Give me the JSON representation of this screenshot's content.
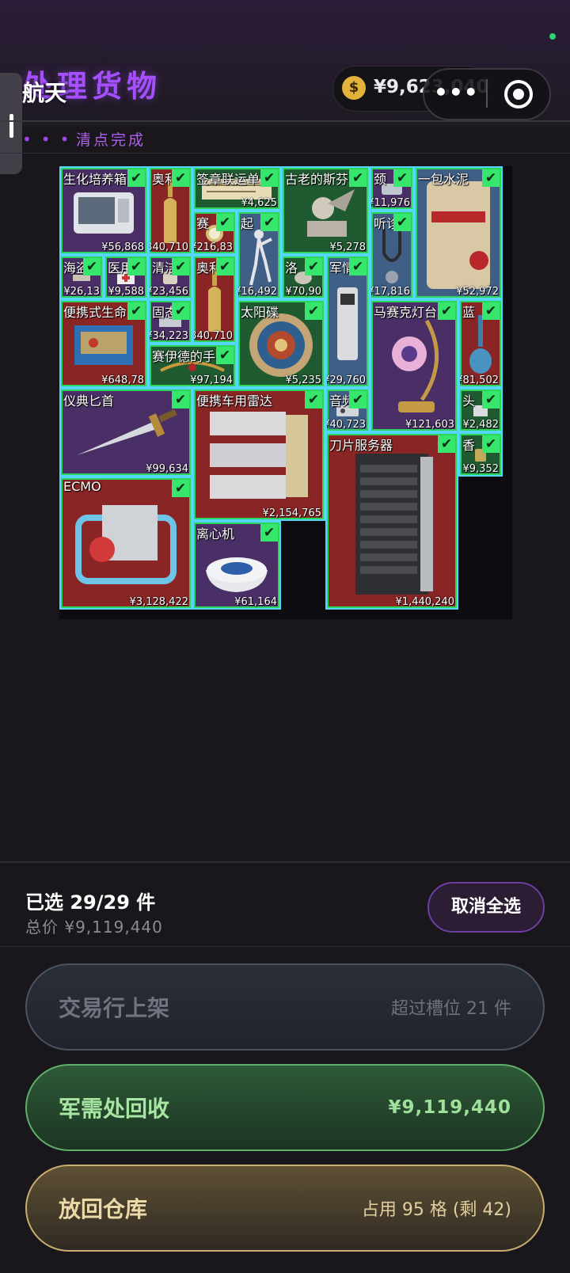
{
  "header": {
    "title": "处理货物",
    "miniprogram_name": "航天",
    "balance": "¥9,623,040",
    "capsule_dots": "•••",
    "status_dots": "•••",
    "status": "清点完成"
  },
  "items": [
    {
      "name": "生化培养箱",
      "price": "¥56,868",
      "bg": "purple"
    },
    {
      "name": "奥利",
      "price": "340,710",
      "bg": "red"
    },
    {
      "name": "签章联运单",
      "price": "¥4,625",
      "bg": "green"
    },
    {
      "name": "古老的斯芬",
      "price": "¥5,278",
      "bg": "green"
    },
    {
      "name": "颈",
      "price": "¥11,976",
      "bg": "purple"
    },
    {
      "name": "一包水泥",
      "price": "¥52,972",
      "bg": "blue"
    },
    {
      "name": "赛",
      "price": "¥216,83",
      "bg": "red"
    },
    {
      "name": "起",
      "price": "¥16,492",
      "bg": "blue"
    },
    {
      "name": "听诊",
      "price": "¥17,816",
      "bg": "blue"
    },
    {
      "name": "海盗",
      "price": "¥26,13",
      "bg": "purple"
    },
    {
      "name": "医用",
      "price": "¥9,588",
      "bg": "purple"
    },
    {
      "name": "清洁",
      "price": "¥23,456",
      "bg": "purple"
    },
    {
      "name": "奥利",
      "price": "340,710",
      "bg": "red"
    },
    {
      "name": "洛",
      "price": "¥70,90",
      "bg": "green"
    },
    {
      "name": "军情",
      "price": "¥29,760",
      "bg": "blue"
    },
    {
      "name": "便携式生命",
      "price": "¥648,78",
      "bg": "red"
    },
    {
      "name": "固态",
      "price": "¥34,223",
      "bg": "purple"
    },
    {
      "name": "太阳碟",
      "price": "¥5,235",
      "bg": "green"
    },
    {
      "name": "马赛克灯台",
      "price": "¥121,603",
      "bg": "purple"
    },
    {
      "name": "蓝",
      "price": "¥81,502",
      "bg": "red"
    },
    {
      "name": "赛伊德的手",
      "price": "¥97,194",
      "bg": "green"
    },
    {
      "name": "仪典匕首",
      "price": "¥99,634",
      "bg": "purple"
    },
    {
      "name": "便携车用雷达",
      "price": "¥2,154,765",
      "bg": "red"
    },
    {
      "name": "音频",
      "price": "¥40,723",
      "bg": "blue"
    },
    {
      "name": "头",
      "price": "¥2,482",
      "bg": "green"
    },
    {
      "name": "刀片服务器",
      "price": "¥1,440,240",
      "bg": "red"
    },
    {
      "name": "香",
      "price": "¥9,352",
      "bg": "green"
    },
    {
      "name": "ECMO",
      "price": "¥3,128,422",
      "bg": "red"
    },
    {
      "name": "离心机",
      "price": "¥61,164",
      "bg": "purple"
    }
  ],
  "summary": {
    "selected": "已选 29/29 件",
    "total": "总价 ¥9,119,440",
    "deselect_label": "取消全选"
  },
  "actions": {
    "market_label": "交易行上架",
    "market_sub": "超过槽位 21 件",
    "recycle_label": "军需处回收",
    "recycle_sub": "¥9,119,440",
    "warehouse_label": "放回仓库",
    "warehouse_sub": "占用 95 格 (剩 42)"
  }
}
